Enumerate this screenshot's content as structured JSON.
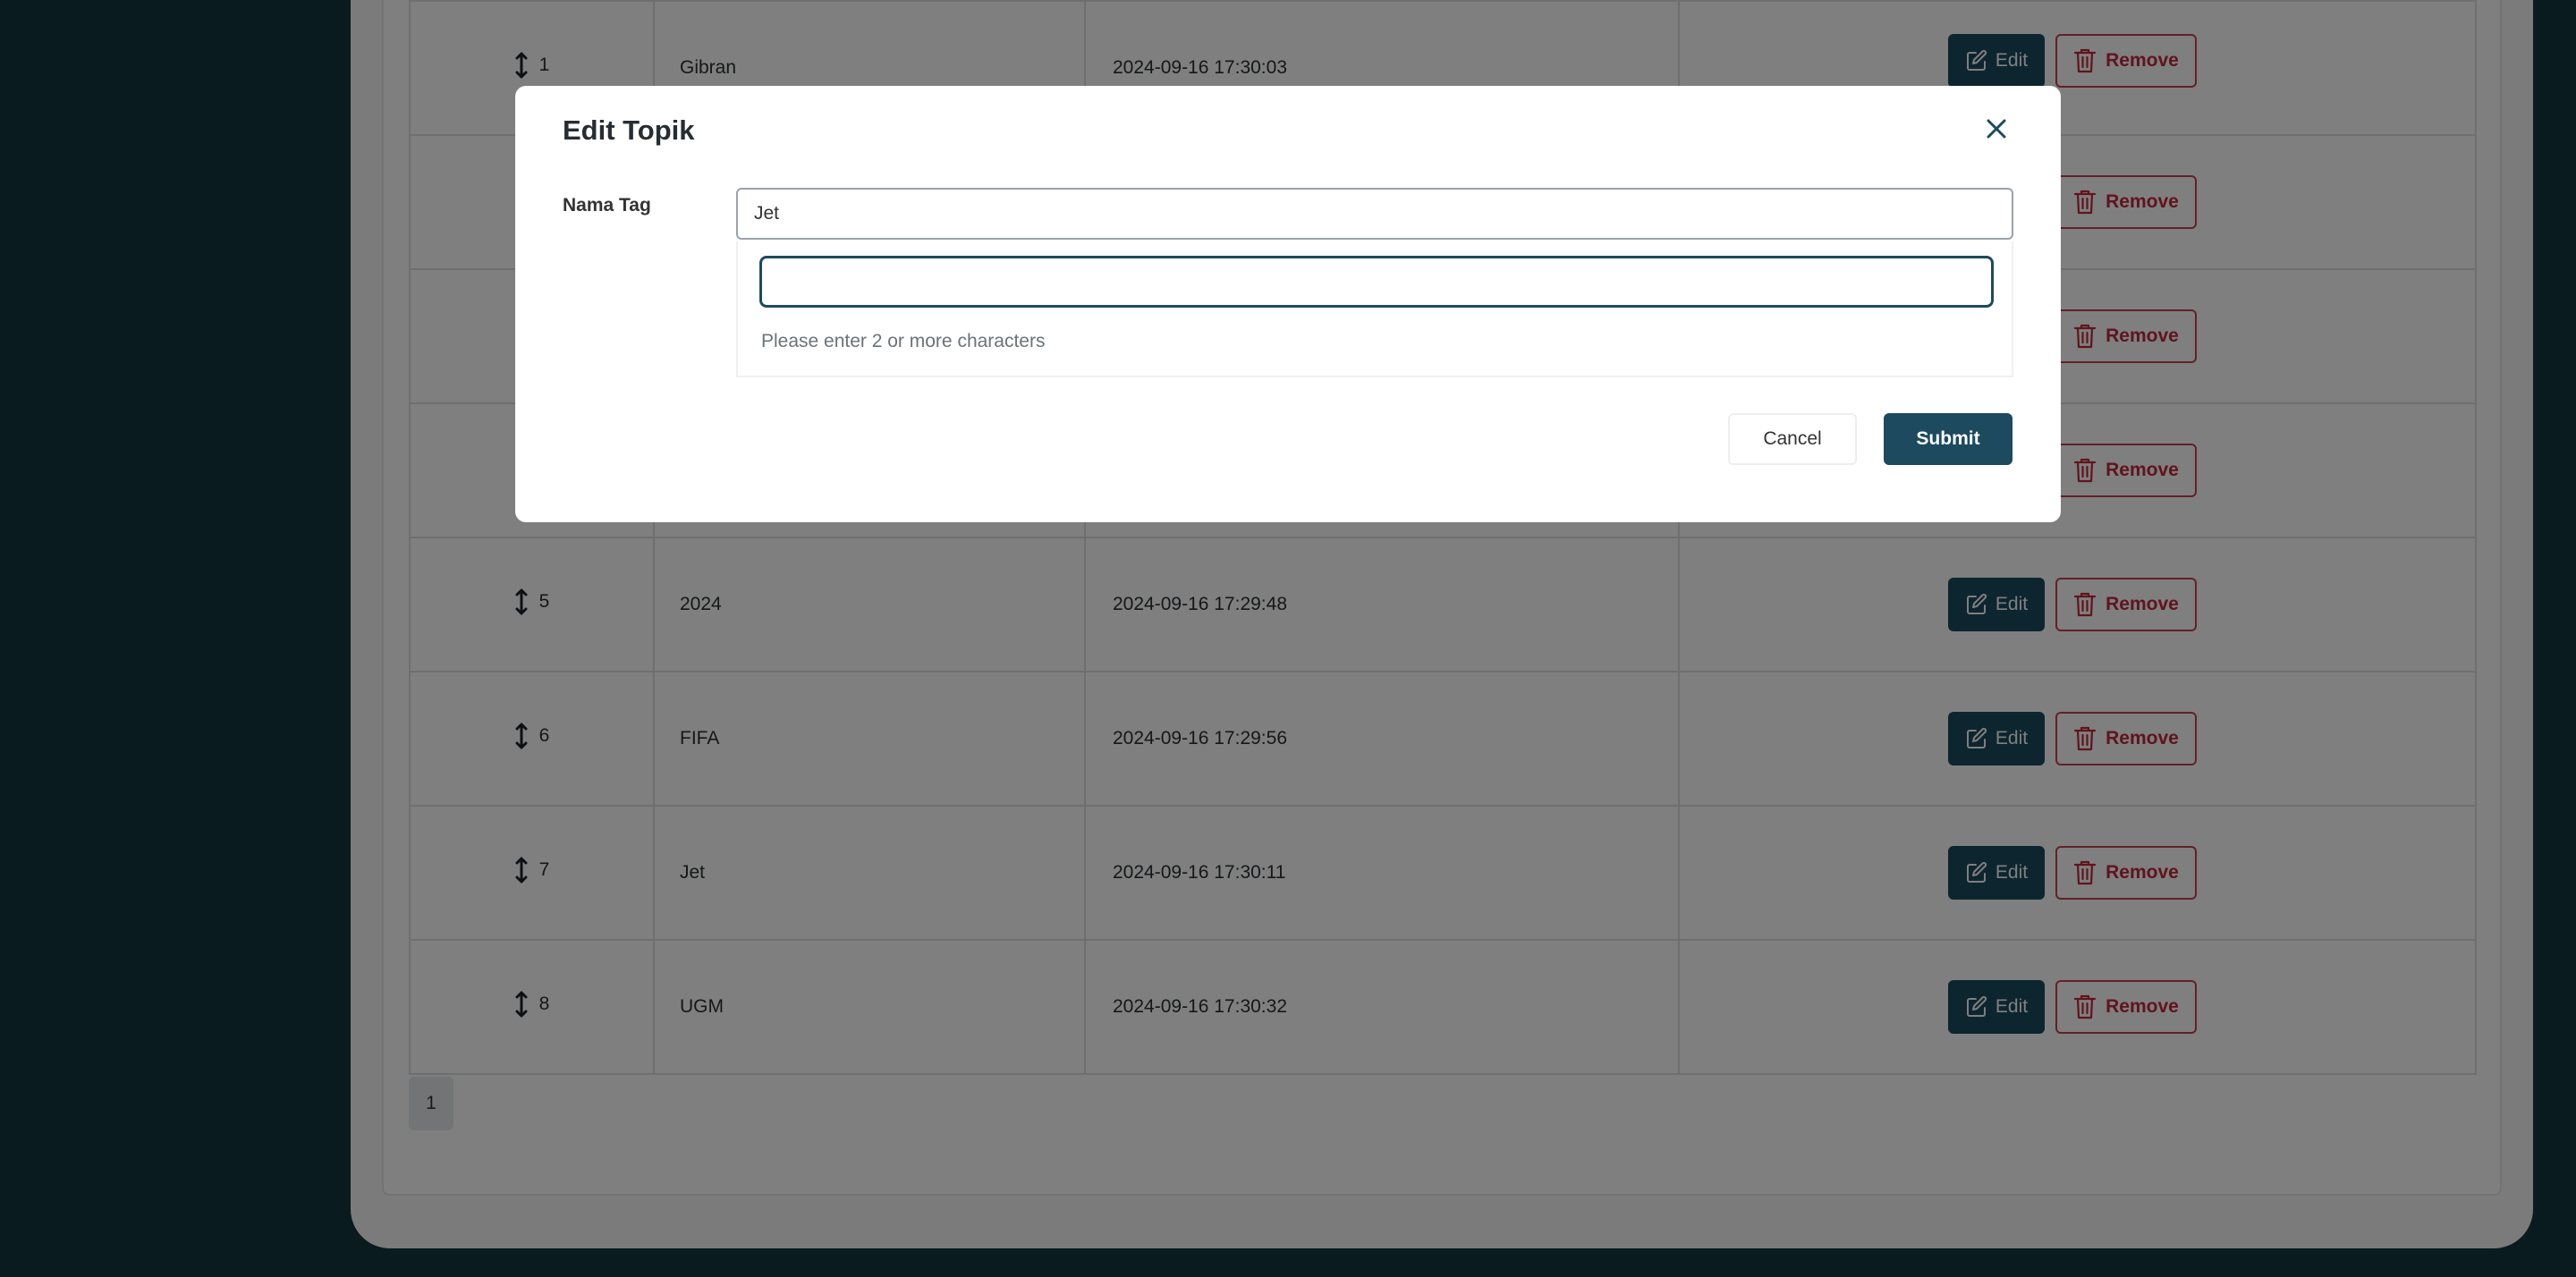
{
  "table": {
    "rows": [
      {
        "order": "1",
        "name": "Gibran",
        "created": "2024-09-16 17:30:03"
      },
      {
        "order": "",
        "name": "",
        "created": ""
      },
      {
        "order": "",
        "name": "",
        "created": ""
      },
      {
        "order": "",
        "name": "",
        "created": ""
      },
      {
        "order": "5",
        "name": "2024",
        "created": "2024-09-16 17:29:48"
      },
      {
        "order": "6",
        "name": "FIFA",
        "created": "2024-09-16 17:29:56"
      },
      {
        "order": "7",
        "name": "Jet",
        "created": "2024-09-16 17:30:11"
      },
      {
        "order": "8",
        "name": "UGM",
        "created": "2024-09-16 17:30:32"
      }
    ],
    "edit_label": "Edit",
    "remove_label": "Remove"
  },
  "pagination": {
    "current_page": "1"
  },
  "modal": {
    "title": "Edit Topik",
    "field_label": "Nama Tag",
    "selected_value": "Jet",
    "search_value": "",
    "hint": "Please enter 2 or more characters",
    "cancel_label": "Cancel",
    "submit_label": "Submit"
  },
  "colors": {
    "primary": "#1d4a5e",
    "danger": "#c0283a",
    "background": "#14363f"
  },
  "icons": {
    "drag": "drag-handle-icon",
    "edit": "edit-icon",
    "remove": "trash-icon",
    "close": "close-icon"
  }
}
